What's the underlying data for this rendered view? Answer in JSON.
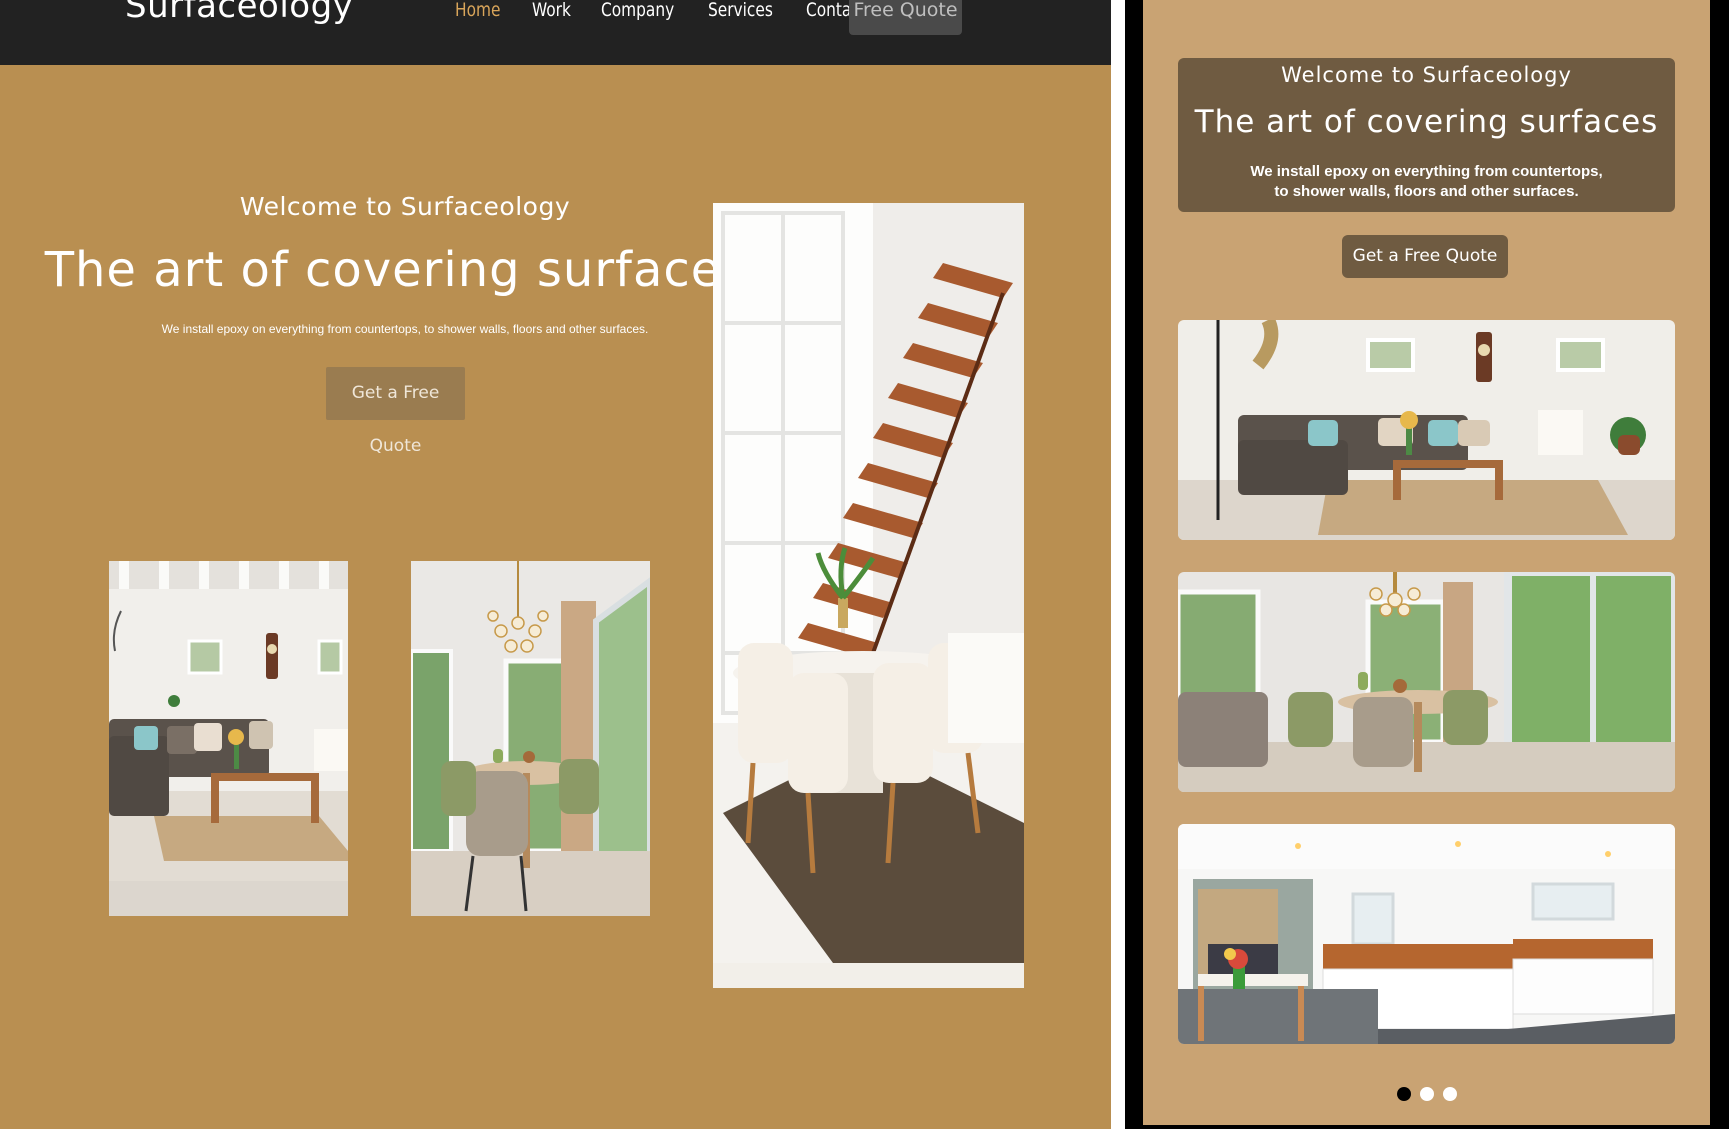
{
  "desktop": {
    "logo": "Surfaceology",
    "nav": {
      "items": [
        {
          "label": "Home",
          "active": true
        },
        {
          "label": "Work"
        },
        {
          "label": "Company"
        },
        {
          "label": "Services"
        },
        {
          "label": "Contact"
        }
      ],
      "quote_label": "Free Quote"
    },
    "hero": {
      "welcome": "Welcome to Surfaceology",
      "title": "The art of covering surfaces",
      "subtitle": "We install epoxy on everything from countertops, to shower walls, floors and other surfaces.",
      "button": "Get a Free Quote"
    },
    "photos": [
      "living-room-photo",
      "dining-room-photo",
      "staircase-dining-photo"
    ]
  },
  "mobile": {
    "welcome": "Welcome to Surfaceology",
    "title": "The art of covering surfaces",
    "subtitle_line1": "We install epoxy on everything from countertops,",
    "subtitle_line2": "to shower walls, floors and other surfaces.",
    "button": "Get a Free Quote",
    "carousel": {
      "slides": [
        "living-room-photo",
        "dining-room-photo",
        "kitchen-photo"
      ],
      "active_index": 0
    }
  },
  "colors": {
    "navbar": "#222222",
    "desktop_background": "#b98f51",
    "accent_active": "#d9a55a",
    "mobile_background": "#c9a373",
    "mobile_banner": "#6f5b41"
  }
}
